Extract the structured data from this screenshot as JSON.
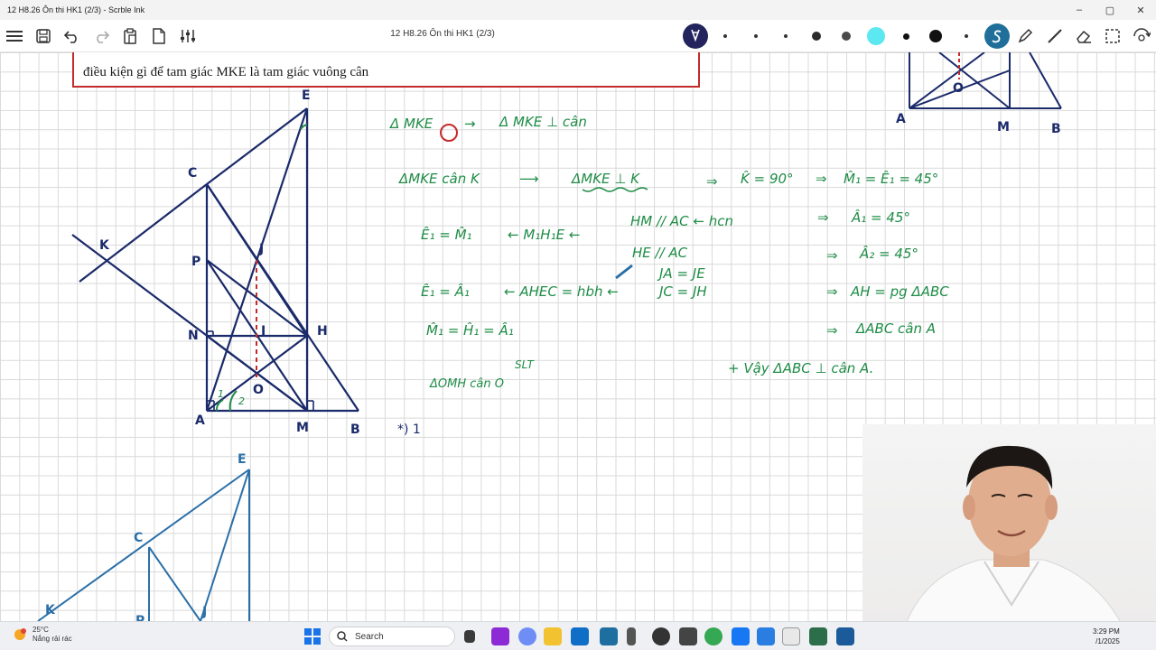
{
  "window": {
    "title": "12 H8.26 Ôn thi HK1 (2/3) - Scrble Ink",
    "minimize": "–",
    "maximize": "▢",
    "close": "✕"
  },
  "toolbar": {
    "doc_title": "12 H8.26 Ôn thi HK1 (2/3)",
    "pen_colors": [
      "#4a4a4a",
      "#2b2b2b",
      "#5ce8f0",
      "#111111",
      "#1f6f9a"
    ]
  },
  "problem": {
    "text": "điều kiện gì để tam giác MKE là tam giác vuông cân"
  },
  "figure_labels": {
    "E": "E",
    "C": "C",
    "K": "K",
    "P": "P",
    "J": "J",
    "I": "I",
    "H": "H",
    "N": "N",
    "O": "O",
    "A": "A",
    "M": "M",
    "B": "B",
    "angle1": "1",
    "angle2": "2"
  },
  "thumb_labels": {
    "A": "A",
    "M": "M",
    "B": "B",
    "O": "O"
  },
  "second_figure_labels": {
    "E": "E",
    "C": "C",
    "K": "K",
    "J": "J",
    "P": "P"
  },
  "notes": {
    "l1a": "Δ MKE",
    "l1b": "→",
    "l1c": "Δ MKE ⊥ cân",
    "l2a": "ΔMKE cân K",
    "l2b": "⟶",
    "l2c": "ΔMKE ⊥ K",
    "l2d": "⇒",
    "l2e": "K̂ = 90°",
    "l2f": "⇒",
    "l2g": "M̂₁ = Ê₁ = 45°",
    "l3a": "Ê₁ = M̂₁",
    "l3b": "← M₁H₁E ←",
    "l3c": "HM // AC ← hcn",
    "l3d": "⇒",
    "l3e": "Â₁ = 45°",
    "l4a": "HE // AC",
    "l4b": "⇒",
    "l4c": "Â₂ = 45°",
    "l5a": "JA = JE",
    "l6a": "Ê₁ = Â₁",
    "l6b": "← AHEC = hbh ←",
    "l6c": "JC = JH",
    "l6d": "⇒",
    "l6e": "AH = pg ΔABC",
    "l7a": "M̂₁ = Ĥ₁ = Â₁",
    "l7b": "⇒",
    "l7c": "ΔABC cân A",
    "l8a": "SLT",
    "l9a": "ΔOMH cân O",
    "l10a": "+ Vậy ΔABC ⊥ cân A.",
    "l11a": "*) 1"
  },
  "taskbar": {
    "weather_temp": "25°C",
    "weather_desc": "Nắng rải rác",
    "search_label": "Search",
    "time": "3:29 PM",
    "date": "/1/2025"
  }
}
